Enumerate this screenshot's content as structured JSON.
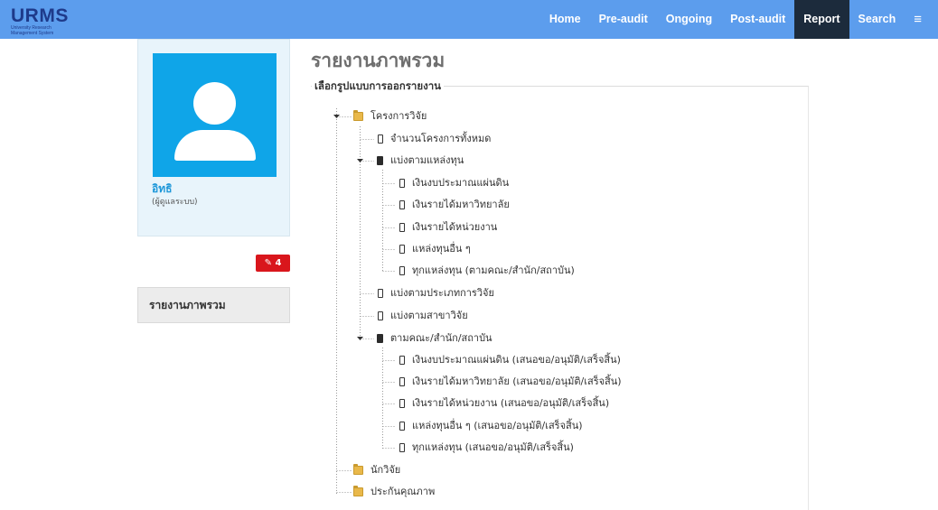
{
  "header": {
    "logo_text": "URMS",
    "logo_subtext": "University Research Management System",
    "nav": [
      {
        "label": "Home",
        "active": false
      },
      {
        "label": "Pre-audit",
        "active": false
      },
      {
        "label": "Ongoing",
        "active": false
      },
      {
        "label": "Post-audit",
        "active": false
      },
      {
        "label": "Report",
        "active": true
      },
      {
        "label": "Search",
        "active": false
      },
      {
        "label": "≡",
        "active": false
      }
    ]
  },
  "sidebar": {
    "user_name": "อิทธิ",
    "user_role": "(ผู้ดูแลระบบ)",
    "notification_count": "4",
    "menu": [
      {
        "label": "รายงานภาพรวม"
      }
    ]
  },
  "main": {
    "page_title": "รายงานภาพรวม",
    "legend": "เลือกรูปแบบการออกรายงาน",
    "tree": [
      {
        "label": "โครงการวิจัย",
        "icon": "folder-icon"
      },
      {
        "label": "จำนวนโครงการทั้งหมด",
        "icon": "file-icon"
      },
      {
        "label": "แบ่งตามแหล่งทุน",
        "icon": "book-icon"
      },
      {
        "label": "เงินงบประมาณแผ่นดิน",
        "icon": "file-icon"
      },
      {
        "label": "เงินรายได้มหาวิทยาลัย",
        "icon": "file-icon"
      },
      {
        "label": "เงินรายได้หน่วยงาน",
        "icon": "file-icon"
      },
      {
        "label": "แหล่งทุนอื่น ๆ",
        "icon": "file-icon"
      },
      {
        "label": "ทุกแหล่งทุน (ตามคณะ/สำนัก/สถาบัน)",
        "icon": "file-icon"
      },
      {
        "label": "แบ่งตามประเภทการวิจัย",
        "icon": "file-icon"
      },
      {
        "label": "แบ่งตามสาขาวิจัย",
        "icon": "file-icon"
      },
      {
        "label": "ตามคณะ/สำนัก/สถาบัน",
        "icon": "book-icon"
      },
      {
        "label": "เงินงบประมาณแผ่นดิน (เสนอขอ/อนุมัติ/เสร็จสิ้น)",
        "icon": "file-icon"
      },
      {
        "label": "เงินรายได้มหาวิทยาลัย (เสนอขอ/อนุมัติ/เสร็จสิ้น)",
        "icon": "file-icon"
      },
      {
        "label": "เงินรายได้หน่วยงาน (เสนอขอ/อนุมัติ/เสร็จสิ้น)",
        "icon": "file-icon"
      },
      {
        "label": "แหล่งทุนอื่น ๆ (เสนอขอ/อนุมัติ/เสร็จสิ้น)",
        "icon": "file-icon"
      },
      {
        "label": "ทุกแหล่งทุน (เสนอขอ/อนุมัติ/เสร็จสิ้น)",
        "icon": "file-icon"
      },
      {
        "label": "นักวิจัย",
        "icon": "folder-icon"
      },
      {
        "label": "ประกันคุณภาพ",
        "icon": "folder-icon"
      }
    ]
  },
  "colors": {
    "header_bg": "#5c9ded",
    "active_nav_bg": "#1c2b3c",
    "avatar_bg": "#0fa5e8",
    "badge_bg": "#d9161c"
  }
}
